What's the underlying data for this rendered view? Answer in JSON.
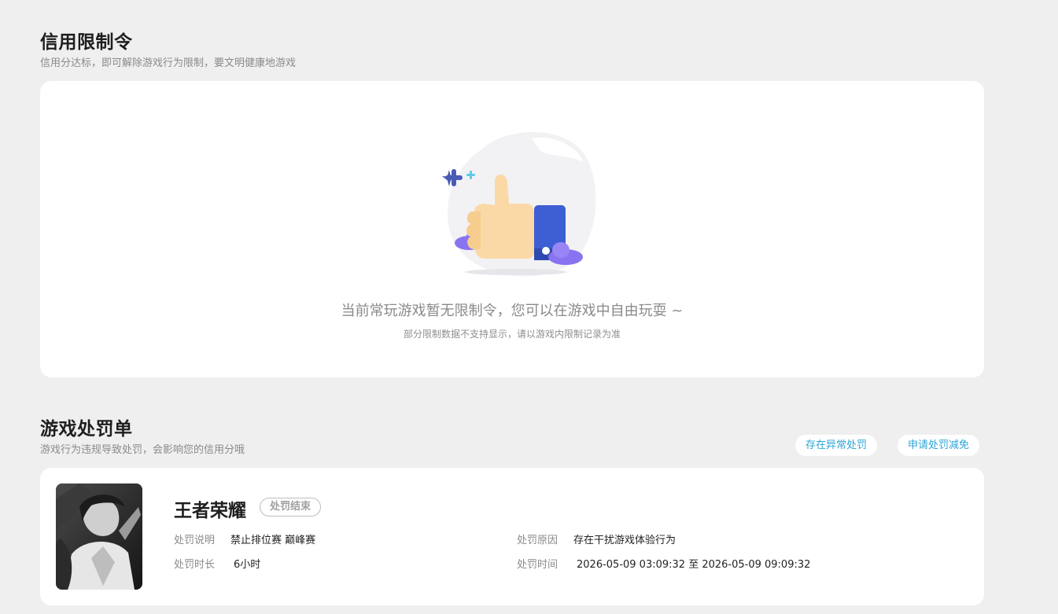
{
  "credit": {
    "title": "信用限制令",
    "subtitle": "信用分达标，即可解除游戏行为限制，要文明健康地游戏",
    "empty_title": "当前常玩游戏暂无限制令，您可以在游戏中自由玩耍 ~",
    "empty_note": "部分限制数据不支持显示，请以游戏内限制记录为准",
    "illustration_icon": "thumbs-up-icon"
  },
  "penalty": {
    "title": "游戏处罚单",
    "subtitle": "游戏行为违规导致处罚，会影响您的信用分哦",
    "buttons": {
      "abnormal": "存在异常处罚",
      "appeal": "申请处罚减免"
    },
    "item": {
      "game": "王者荣耀",
      "status": "处罚结束",
      "desc_label": "处罚说明",
      "desc_value": "禁止排位赛 巅峰赛",
      "duration_label": "处罚时长",
      "duration_value": "6小时",
      "reason_label": "处罚原因",
      "reason_value": "存在干扰游戏体验行为",
      "time_label": "处罚时间",
      "time_value": "2026-05-09 03:09:32 至 2026-05-09 09:09:32"
    }
  },
  "colors": {
    "accent": "#2ca6d6",
    "background": "#efefef",
    "card": "#ffffff",
    "thumb_blue": "#3d5fd3",
    "cloud_purple": "#8a73f0"
  }
}
